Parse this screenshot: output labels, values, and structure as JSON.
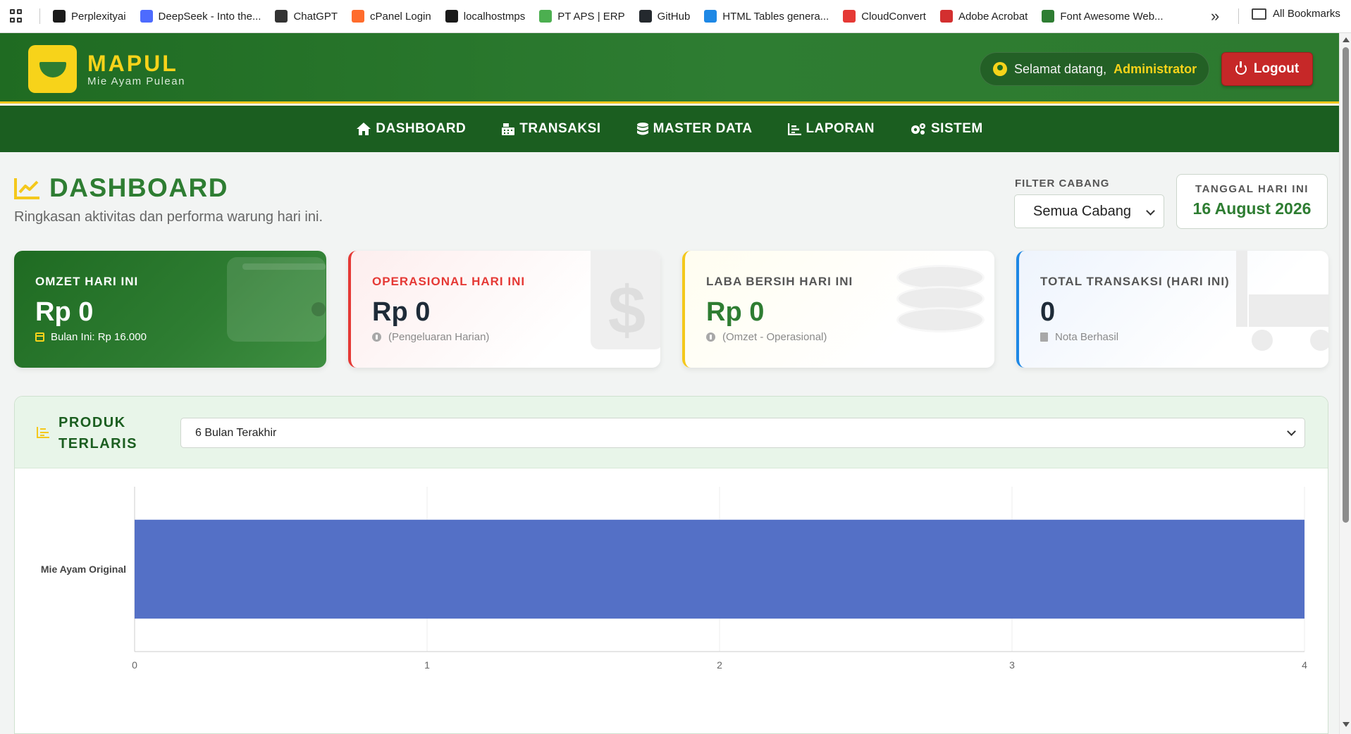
{
  "bookmarks": {
    "items": [
      {
        "label": "Perplexityai",
        "icon": "perplexity-icon",
        "color": "#1a1a1a"
      },
      {
        "label": "DeepSeek - Into the...",
        "icon": "deepseek-icon",
        "color": "#4d6bfe"
      },
      {
        "label": "ChatGPT",
        "icon": "chatgpt-icon",
        "color": "#333333"
      },
      {
        "label": "cPanel Login",
        "icon": "cpanel-icon",
        "color": "#ff6c2c"
      },
      {
        "label": "localhostmps",
        "icon": "localhost-icon",
        "color": "#1a1a1a"
      },
      {
        "label": "PT APS | ERP",
        "icon": "vue-icon",
        "color": "#4caf50"
      },
      {
        "label": "GitHub",
        "icon": "github-icon",
        "color": "#24292e"
      },
      {
        "label": "HTML Tables genera...",
        "icon": "table-icon",
        "color": "#1e88e5"
      },
      {
        "label": "CloudConvert",
        "icon": "cloudconvert-icon",
        "color": "#e53935"
      },
      {
        "label": "Adobe Acrobat",
        "icon": "acrobat-icon",
        "color": "#d32f2f"
      },
      {
        "label": "Font Awesome Web...",
        "icon": "fontawesome-icon",
        "color": "#2e7d32"
      }
    ],
    "more": "»",
    "all_label": "All Bookmarks"
  },
  "header": {
    "brand_title": "MAPUL",
    "brand_sub": "Mie Ayam Pulean",
    "welcome_prefix": "Selamat datang,",
    "username": "Administrator",
    "logout_label": "Logout"
  },
  "nav": {
    "items": [
      {
        "label": "DASHBOARD",
        "icon": "home-icon"
      },
      {
        "label": "TRANSAKSI",
        "icon": "cash-register-icon"
      },
      {
        "label": "MASTER DATA",
        "icon": "database-icon"
      },
      {
        "label": "LAPORAN",
        "icon": "chart-line-icon"
      },
      {
        "label": "SISTEM",
        "icon": "gears-icon"
      }
    ]
  },
  "page": {
    "title": "DASHBOARD",
    "subtitle": "Ringkasan aktivitas dan performa warung hari ini.",
    "filter_label": "FILTER CABANG",
    "filter_value": "Semua Cabang",
    "date_label": "TANGGAL HARI INI",
    "date_value": "16 August 2026"
  },
  "cards": [
    {
      "label": "OMZET HARI INI",
      "value": "Rp 0",
      "note": "Bulan Ini: Rp 16.000",
      "icon": "wallet-icon"
    },
    {
      "label": "OPERASIONAL HARI INI",
      "value": "Rp 0",
      "note": "(Pengeluaran Harian)",
      "icon": "dollar-icon"
    },
    {
      "label": "LABA BERSIH HARI INI",
      "value": "Rp 0",
      "note": "(Omzet - Operasional)",
      "icon": "coins-icon"
    },
    {
      "label": "TOTAL TRANSAKSI (HARI INI)",
      "value": "0",
      "note": "Nota Berhasil",
      "icon": "cart-icon"
    }
  ],
  "colors": {
    "brand_green": "#2e7d32",
    "nav_green": "#1b5e20",
    "brand_yellow": "#f7d31a",
    "danger": "#e53935",
    "info": "#1e88e5",
    "bar": "#5470c6"
  },
  "panel": {
    "title": "PRODUK TERLARIS",
    "period_value": "6 Bulan Terakhir"
  },
  "chart_data": {
    "type": "bar",
    "orientation": "horizontal",
    "categories": [
      "Mie Ayam Original"
    ],
    "values": [
      4
    ],
    "xlim": [
      0,
      4
    ],
    "xticks": [
      0,
      1,
      2,
      3,
      4
    ],
    "grid": true,
    "legend": "none"
  }
}
